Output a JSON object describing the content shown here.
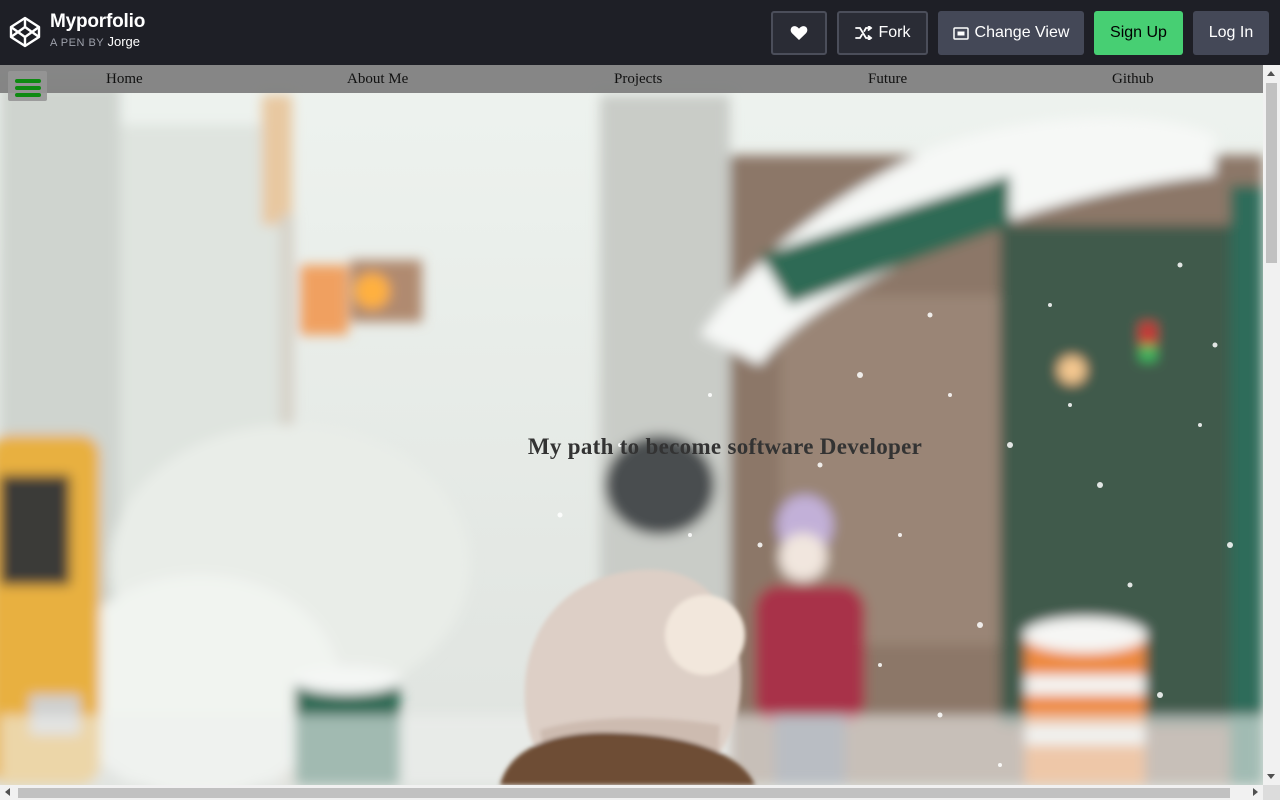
{
  "codepen": {
    "pen_title": "Myporfolio",
    "by_label": "A PEN BY",
    "author": "Jorge",
    "buttons": {
      "heart_icon": "heart-icon",
      "fork": "Fork",
      "change_view": "Change View",
      "sign_up": "Sign Up",
      "log_in": "Log In"
    },
    "colors": {
      "header_bg": "#1e1f26",
      "button_bg": "#444857",
      "signup_bg": "#47cf73"
    }
  },
  "site": {
    "nav": {
      "menu_icon": "hamburger-icon",
      "items": [
        {
          "label": "Home"
        },
        {
          "label": "About Me"
        },
        {
          "label": "Projects"
        },
        {
          "label": "Future"
        },
        {
          "label": "Github"
        }
      ]
    },
    "hero": {
      "title": "My path to become software Developer"
    },
    "colors": {
      "nav_bg": "#808080",
      "menu_icon": "#0e8a12"
    }
  }
}
